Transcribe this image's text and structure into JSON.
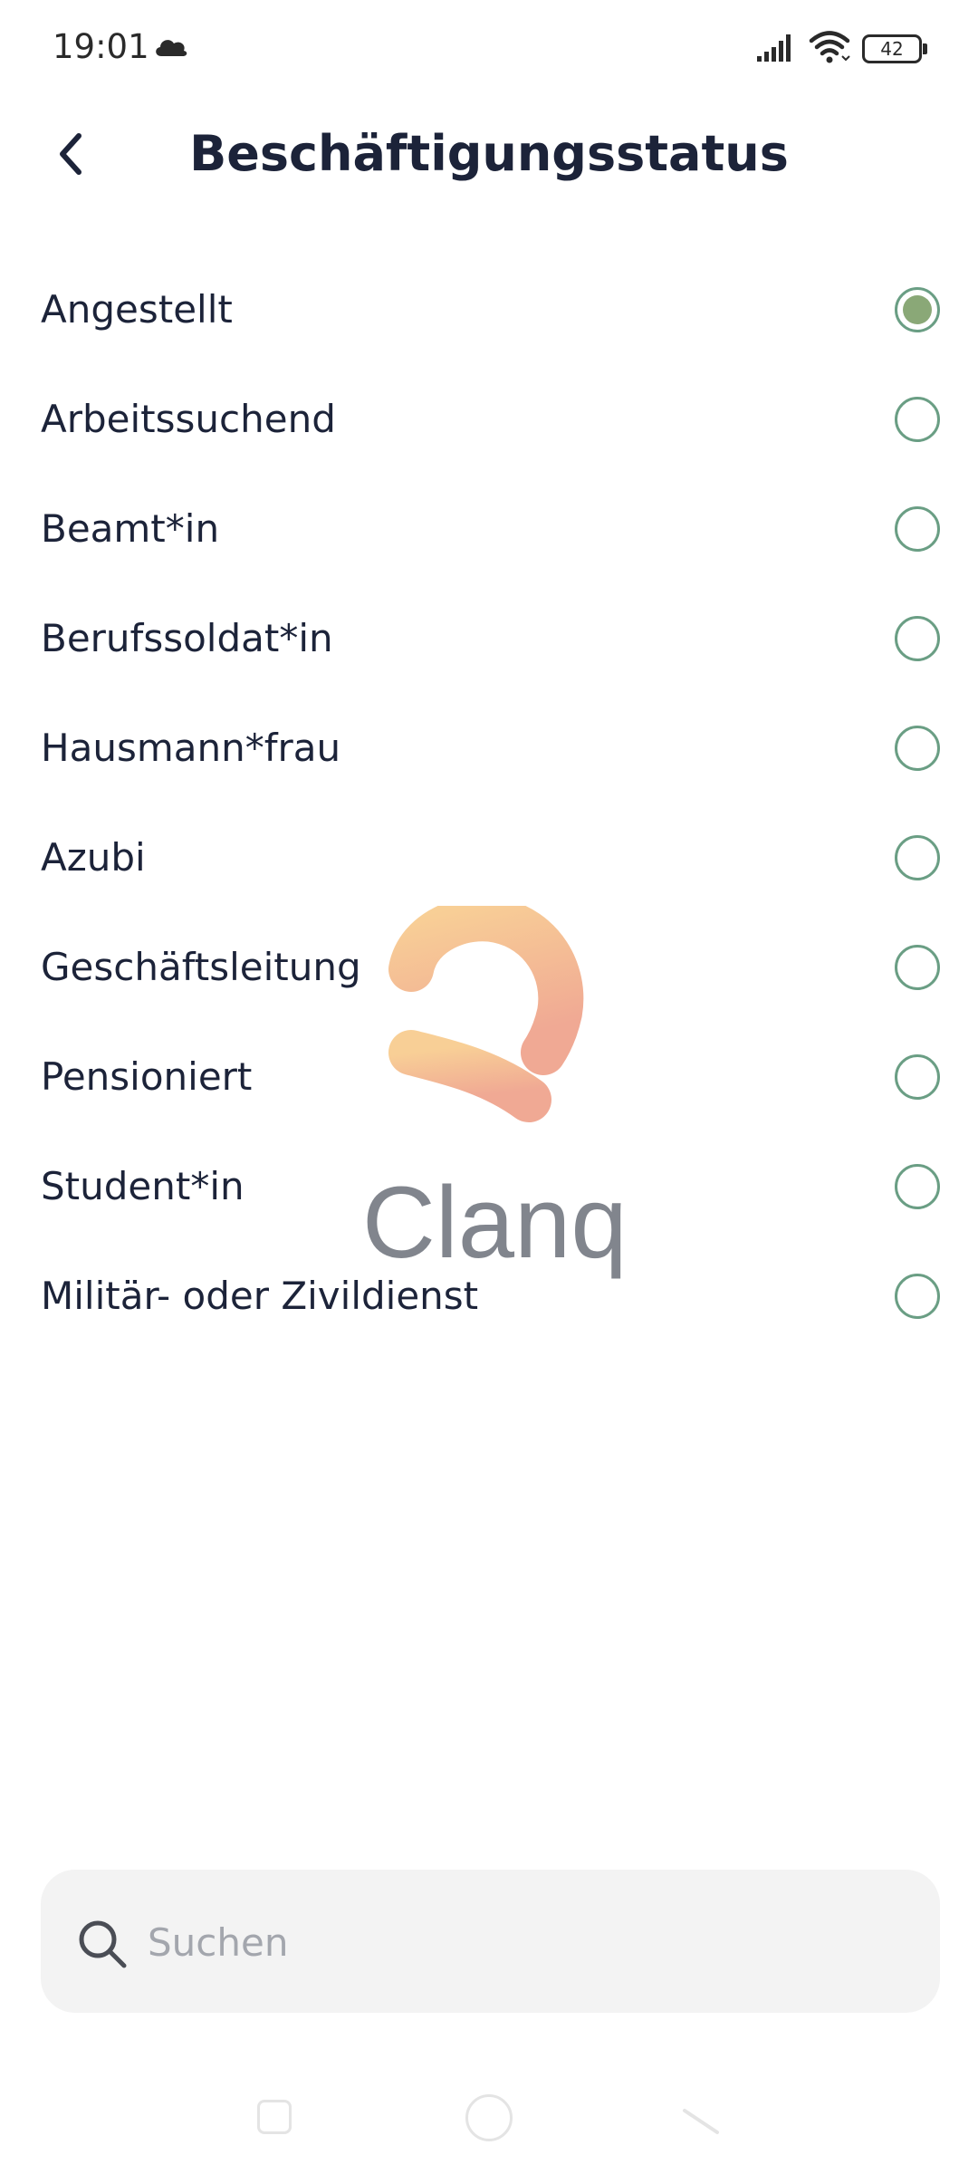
{
  "status_bar": {
    "time": "19:01",
    "battery": "42",
    "icons": [
      "cloud-icon",
      "signal-icon",
      "wifi-icon",
      "battery-icon"
    ]
  },
  "header": {
    "title": "Beschäftigungsstatus",
    "back_icon": "chevron-left-icon"
  },
  "options": [
    {
      "label": "Angestellt",
      "selected": true
    },
    {
      "label": "Arbeitssuchend",
      "selected": false
    },
    {
      "label": "Beamt*in",
      "selected": false
    },
    {
      "label": "Berufssoldat*in",
      "selected": false
    },
    {
      "label": "Hausmann*frau",
      "selected": false
    },
    {
      "label": "Azubi",
      "selected": false
    },
    {
      "label": "Geschäftsleitung",
      "selected": false
    },
    {
      "label": "Pensioniert",
      "selected": false
    },
    {
      "label": "Student*in",
      "selected": false
    },
    {
      "label": "Militär- oder Zivildienst",
      "selected": false
    }
  ],
  "watermark": {
    "text": "Clanq"
  },
  "search": {
    "placeholder": "Suchen",
    "value": ""
  },
  "colors": {
    "accent": "#6a9e84",
    "selected_fill": "#8aa877",
    "title": "#1c2339",
    "search_bg": "#f3f3f3"
  }
}
